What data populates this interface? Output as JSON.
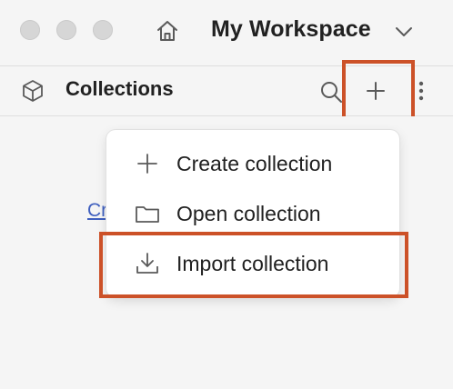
{
  "titlebar": {
    "workspace_name": "My Workspace",
    "home_icon": "home-icon",
    "chevron_icon": "chevron-down-icon",
    "traffic_light_color": "#d6d6d6"
  },
  "sidebar_header": {
    "title": "Collections",
    "icon": "cube-icon",
    "search_icon": "search-icon",
    "new_icon": "plus-icon",
    "more_icon": "more-vertical-icon"
  },
  "content": {
    "create_link_text": "Cr"
  },
  "menu": {
    "items": [
      {
        "label": "Create collection",
        "icon": "plus-icon"
      },
      {
        "label": "Open collection",
        "icon": "folder-icon"
      },
      {
        "label": "Import collection",
        "icon": "import-icon"
      }
    ]
  },
  "colors": {
    "highlight": "#cc5128",
    "link": "#3f5fbf",
    "background": "#f5f5f5",
    "menu_background": "#ffffff"
  }
}
